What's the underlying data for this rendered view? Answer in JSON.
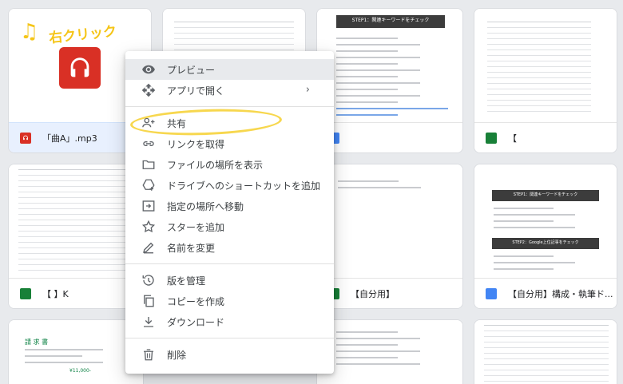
{
  "annotation_text": "右クリック",
  "files": [
    {
      "name": "「曲A」.mp3",
      "type": "audio"
    },
    {
      "name": "",
      "type": "sheet"
    },
    {
      "name": "",
      "type": "doc"
    },
    {
      "name": "【",
      "type": "sheet"
    },
    {
      "name": "【                    】K",
      "type": "sheet"
    },
    {
      "name": "",
      "type": "doc"
    },
    {
      "name": "【自分用】",
      "type": "sheet"
    },
    {
      "name": "【自分用】構成・執筆ド...",
      "type": "doc"
    }
  ],
  "thumbs": {
    "step1": "STEP1：関連キーワードをチェック",
    "step2": "STEP2：Google上位記事をチェック",
    "invoice": "請 求 書",
    "amount": "¥11,000-"
  },
  "menu": {
    "items": [
      {
        "label": "プレビュー",
        "icon": "eye-icon"
      },
      {
        "label": "アプリで開く",
        "icon": "open-with-icon"
      },
      {
        "label": "共有",
        "icon": "person-add-icon"
      },
      {
        "label": "リンクを取得",
        "icon": "link-icon"
      },
      {
        "label": "ファイルの場所を表示",
        "icon": "folder-icon"
      },
      {
        "label": "ドライブへのショートカットを追加",
        "icon": "shortcut-icon"
      },
      {
        "label": "指定の場所へ移動",
        "icon": "move-icon"
      },
      {
        "label": "スターを追加",
        "icon": "star-icon"
      },
      {
        "label": "名前を変更",
        "icon": "pencil-icon"
      },
      {
        "label": "版を管理",
        "icon": "history-icon"
      },
      {
        "label": "コピーを作成",
        "icon": "copy-icon"
      },
      {
        "label": "ダウンロード",
        "icon": "download-icon"
      },
      {
        "label": "削除",
        "icon": "trash-icon"
      }
    ]
  },
  "colors": {
    "accent_annotation": "#f5c518",
    "audio": "#d93025",
    "sheet": "#188038",
    "doc": "#4285f4",
    "selected": "#e8f0fe"
  }
}
